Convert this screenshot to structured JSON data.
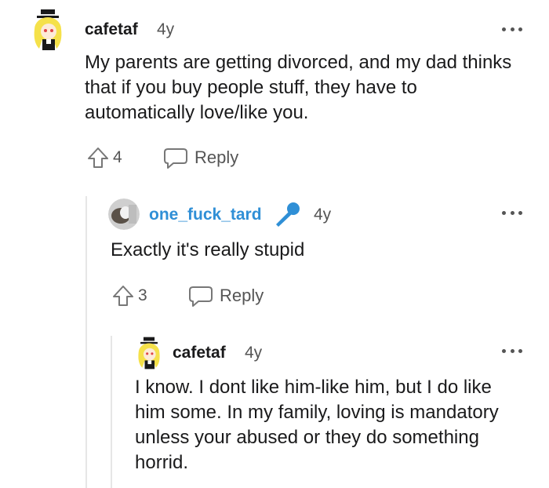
{
  "comments": [
    {
      "username": "cafetaf",
      "age": "4y",
      "text": "My parents are getting divorced, and my dad thinks that if you buy people stuff, they have to automatically love/like you.",
      "votes": "4",
      "reply_label": "Reply"
    },
    {
      "username": "one_fuck_tard",
      "age": "4y",
      "text": "Exactly it's really stupid",
      "votes": "3",
      "reply_label": "Reply",
      "username_color": "#2f8fd6"
    },
    {
      "username": "cafetaf",
      "age": "4y",
      "text": "I know. I dont like him-like him, but I do like him some. In my family, loving is mandatory unless your abused or they do something horrid."
    }
  ],
  "colors": {
    "text": "#1a1a1b",
    "muted": "#555555",
    "link_blue": "#2f8fd6",
    "thread_line": "#e6e6e6"
  },
  "icons": [
    "avatar-cafetaf",
    "avatar-one-fuck-tard",
    "mic-icon",
    "upvote-icon",
    "reply-bubble-icon",
    "more-dots-icon"
  ]
}
